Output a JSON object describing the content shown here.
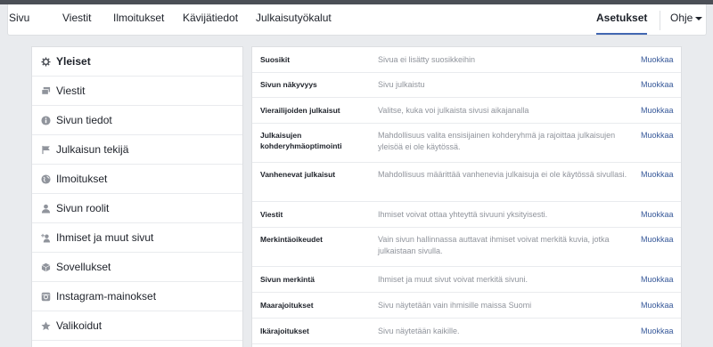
{
  "nav": {
    "items": [
      "Sivu",
      "Viestit",
      "Ilmoitukset",
      "Kävijätiedot",
      "Julkaisutyökalut"
    ],
    "settings": "Asetukset",
    "help": "Ohje"
  },
  "sidebar": {
    "items": [
      {
        "label": "Yleiset",
        "icon": "gear-icon"
      },
      {
        "label": "Viestit",
        "icon": "messages-icon"
      },
      {
        "label": "Sivun tiedot",
        "icon": "info-icon"
      },
      {
        "label": "Julkaisun tekijä",
        "icon": "flag-icon"
      },
      {
        "label": "Ilmoitukset",
        "icon": "globe-icon"
      },
      {
        "label": "Sivun roolit",
        "icon": "person-icon"
      },
      {
        "label": "Ihmiset ja muut sivut",
        "icon": "person-add-icon"
      },
      {
        "label": "Sovellukset",
        "icon": "cube-icon"
      },
      {
        "label": "Instagram-mainokset",
        "icon": "instagram-icon"
      },
      {
        "label": "Valikoidut",
        "icon": "star-icon"
      }
    ]
  },
  "settings": {
    "edit_label": "Muokkaa",
    "rows": [
      {
        "label": "Suosikit",
        "value": "Sivua ei lisätty suosikkeihin"
      },
      {
        "label": "Sivun näkyvyys",
        "value": "Sivu julkaistu"
      },
      {
        "label": "Vierailijoiden julkaisut",
        "value": "Valitse, kuka voi julkaista sivusi aikajanalla"
      },
      {
        "label": "Julkaisujen kohderyhmäoptimointi",
        "value": "Mahdollisuus valita ensisijainen kohderyhmä ja rajoittaa julkaisujen yleisöä ei ole käytössä."
      },
      {
        "label": "Vanhenevat julkaisut",
        "value": "Mahdollisuus määrittää vanhenevia julkaisuja ei ole käytössä sivullasi."
      },
      {
        "label": "Viestit",
        "value": "Ihmiset voivat ottaa yhteyttä sivuuni yksityisesti."
      },
      {
        "label": "Merkintäoikeudet",
        "value": "Vain sivun hallinnassa auttavat ihmiset voivat merkitä kuvia, jotka julkaistaan sivulla."
      },
      {
        "label": "Sivun merkintä",
        "value": "Ihmiset ja muut sivut voivat merkitä sivuni."
      },
      {
        "label": "Maarajoitukset",
        "value": "Sivu näytetään vain ihmisille maissa Suomi"
      },
      {
        "label": "Ikärajoitukset",
        "value": "Sivu näytetään kaikille."
      }
    ]
  }
}
